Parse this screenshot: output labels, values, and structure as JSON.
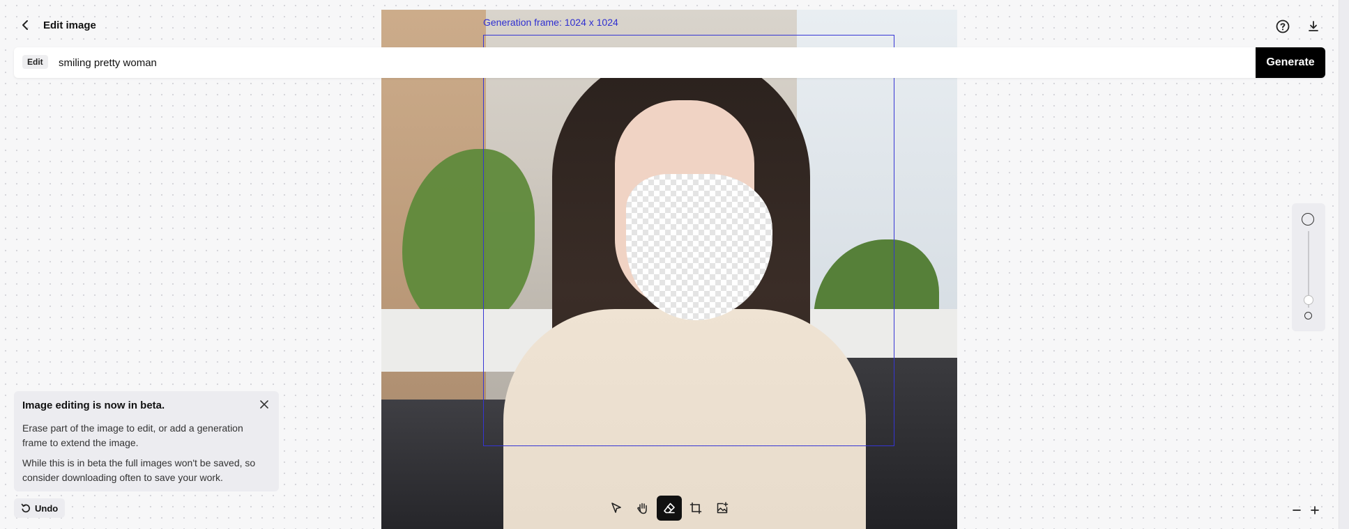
{
  "header": {
    "title": "Edit image",
    "back_icon": "arrow-left-icon",
    "help_icon": "help-circle-icon",
    "download_icon": "download-icon"
  },
  "canvas": {
    "generation_frame_label": "Generation frame: 1024 x 1024",
    "frame_color": "#3535d4"
  },
  "prompt": {
    "tag": "Edit",
    "value": "smiling pretty woman",
    "generate_label": "Generate"
  },
  "info_card": {
    "title": "Image editing is now in beta.",
    "paragraph1": "Erase part of the image to edit, or add a generation frame to extend the image.",
    "paragraph2": "While this is in beta the full images won't be saved, so consider downloading often to save your work."
  },
  "undo": {
    "label": "Undo"
  },
  "toolbar": {
    "tools": [
      {
        "name": "select-tool",
        "icon": "cursor-icon",
        "active": false
      },
      {
        "name": "pan-tool",
        "icon": "hand-icon",
        "active": false
      },
      {
        "name": "eraser-tool",
        "icon": "eraser-icon",
        "active": true
      },
      {
        "name": "generation-frame-tool",
        "icon": "frame-icon",
        "active": false
      },
      {
        "name": "add-image-tool",
        "icon": "image-add-icon",
        "active": false
      }
    ]
  },
  "brush_size": {
    "level_fraction": 0.1
  },
  "zoom": {
    "out_icon": "minus-icon",
    "in_icon": "plus-icon"
  }
}
